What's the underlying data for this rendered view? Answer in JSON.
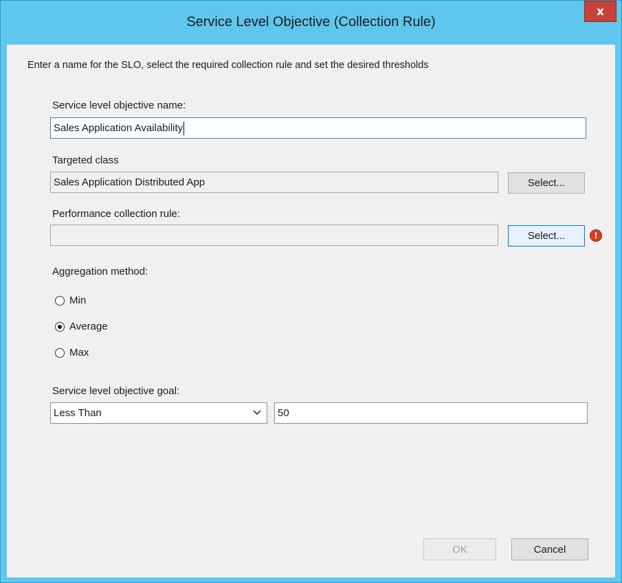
{
  "window": {
    "title": "Service Level Objective (Collection Rule)",
    "close_glyph": "x"
  },
  "intro": "Enter a name for the SLO, select the required collection rule and set the desired thresholds",
  "slo_name": {
    "label": "Service level objective name:",
    "value": "Sales Application Availability"
  },
  "targeted_class": {
    "label": "Targeted class",
    "value": "Sales Application Distributed App",
    "button": "Select..."
  },
  "perf_rule": {
    "label": "Performance collection rule:",
    "value": "",
    "button": "Select...",
    "status_icon": "error-icon",
    "icon_glyph": "!"
  },
  "aggregation": {
    "label": "Aggregation method:",
    "options": [
      {
        "label": "Min",
        "selected": false
      },
      {
        "label": "Average",
        "selected": true
      },
      {
        "label": "Max",
        "selected": false
      }
    ]
  },
  "goal": {
    "label": "Service level objective goal:",
    "comparison": "Less Than",
    "value": "50"
  },
  "footer": {
    "ok": "OK",
    "cancel": "Cancel"
  },
  "colors": {
    "frame": "#5fc6ee",
    "close": "#c7423a",
    "client": "#f0f0f0",
    "error": "#d9401c"
  }
}
